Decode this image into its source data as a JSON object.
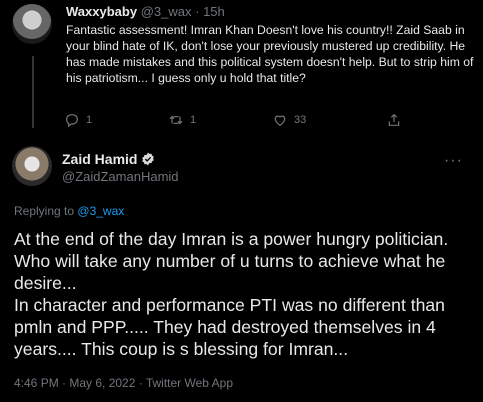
{
  "reply": {
    "name": "Waxxybaby",
    "handle": "@3_wax",
    "time": "15h",
    "text": "Fantastic assessment! Imran Khan Doesn't love his country!! Zaid Saab in your blind hate of IK, don't lose your previously mustered up credibility. He has made mistakes and this political system doesn't help. But to strip him of his patriotism... I guess only u hold that title?",
    "actions": {
      "reply_count": "1",
      "retweet_count": "1",
      "like_count": "33"
    }
  },
  "tweet": {
    "name": "Zaid Hamid",
    "handle": "@ZaidZamanHamid",
    "replying_label": "Replying to",
    "replying_to": "@3_wax",
    "text": "At the end of the day Imran is a power hungry politician. Who will take any number of u turns to achieve what he desire...\nIn character and performance PTI was no different than pmln and PPP..... They had destroyed themselves in 4 years.... This coup is s blessing for Imran...",
    "meta": "4:46 PM · May 6, 2022 · Twitter Web App"
  },
  "icons": {
    "reply": "reply-icon",
    "retweet": "retweet-icon",
    "like": "heart-icon",
    "share": "share-icon",
    "verified": "verified-badge-icon",
    "more": "more-icon"
  },
  "colors": {
    "background": "#000000",
    "text": "#e7e9ea",
    "muted": "#71767b",
    "link": "#1d9bf0"
  }
}
